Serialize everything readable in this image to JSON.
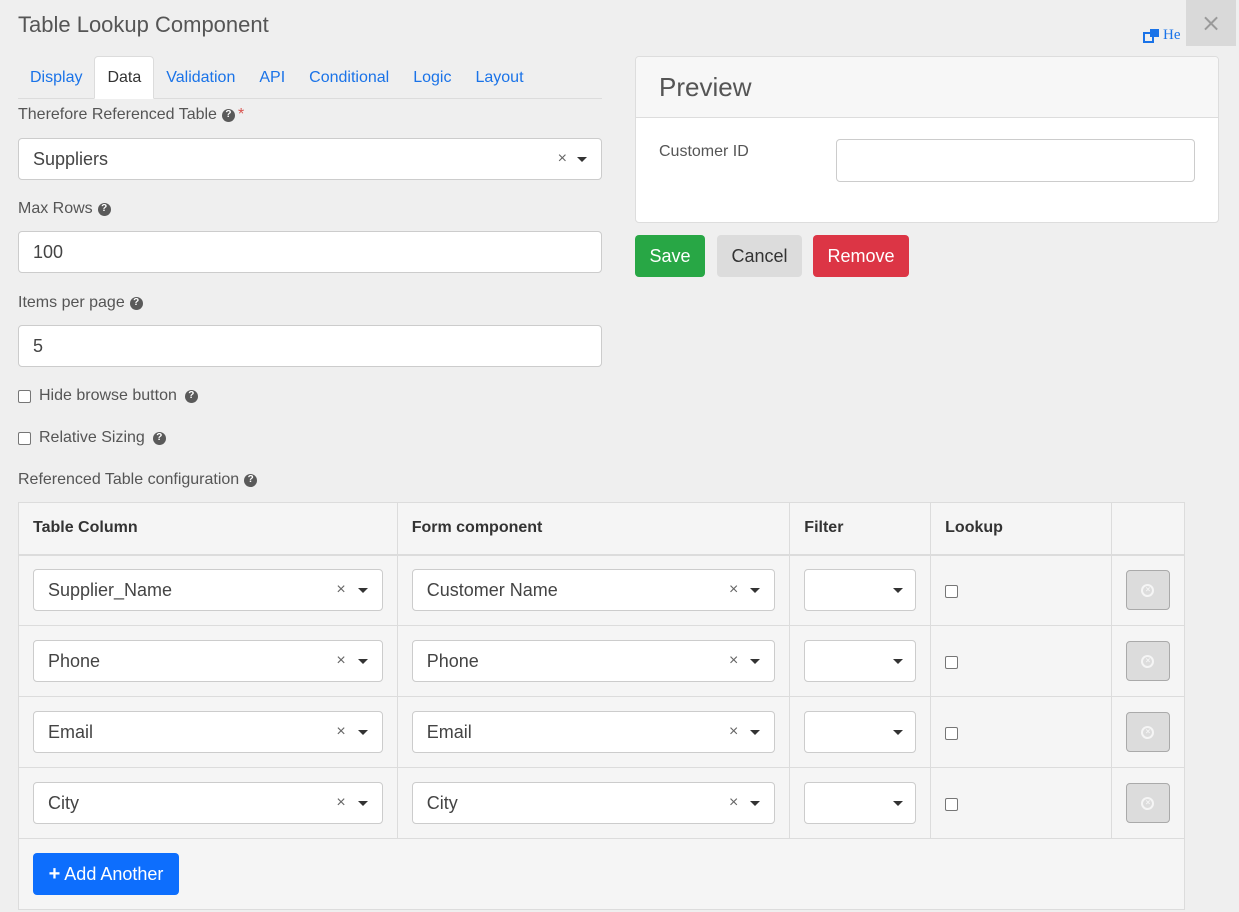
{
  "dialog": {
    "title": "Table Lookup Component",
    "help_label": "He",
    "close_glyph": "×"
  },
  "tabs": [
    {
      "label": "Display",
      "active": false
    },
    {
      "label": "Data",
      "active": true
    },
    {
      "label": "Validation",
      "active": false
    },
    {
      "label": "API",
      "active": false
    },
    {
      "label": "Conditional",
      "active": false
    },
    {
      "label": "Logic",
      "active": false
    },
    {
      "label": "Layout",
      "active": false
    }
  ],
  "form": {
    "referenced_table": {
      "label": "Therefore Referenced Table",
      "required_mark": "*",
      "value": "Suppliers"
    },
    "max_rows": {
      "label": "Max Rows",
      "value": "100"
    },
    "items_per_page": {
      "label": "Items per page",
      "value": "5"
    },
    "hide_browse": {
      "label": "Hide browse button",
      "checked": false
    },
    "relative_sizing": {
      "label": "Relative Sizing",
      "checked": false
    },
    "config_label": "Referenced Table configuration"
  },
  "preview": {
    "title": "Preview",
    "field_label": "Customer ID",
    "field_value": ""
  },
  "actions": {
    "save": "Save",
    "cancel": "Cancel",
    "remove": "Remove"
  },
  "table": {
    "headers": [
      "Table Column",
      "Form component",
      "Filter",
      "Lookup",
      ""
    ],
    "rows": [
      {
        "column": "Supplier_Name",
        "component": "Customer Name",
        "filter": "",
        "lookup": false
      },
      {
        "column": "Phone",
        "component": "Phone",
        "filter": "",
        "lookup": false
      },
      {
        "column": "Email",
        "component": "Email",
        "filter": "",
        "lookup": false
      },
      {
        "column": "City",
        "component": "City",
        "filter": "",
        "lookup": false
      }
    ],
    "add_label": "Add Another"
  },
  "icons": {
    "clear": "×",
    "help": "?",
    "plus": "+"
  },
  "colors": {
    "link": "#1a73e8",
    "save": "#28a745",
    "remove": "#dc3545",
    "add": "#0d6efd",
    "required": "#d9534f"
  }
}
